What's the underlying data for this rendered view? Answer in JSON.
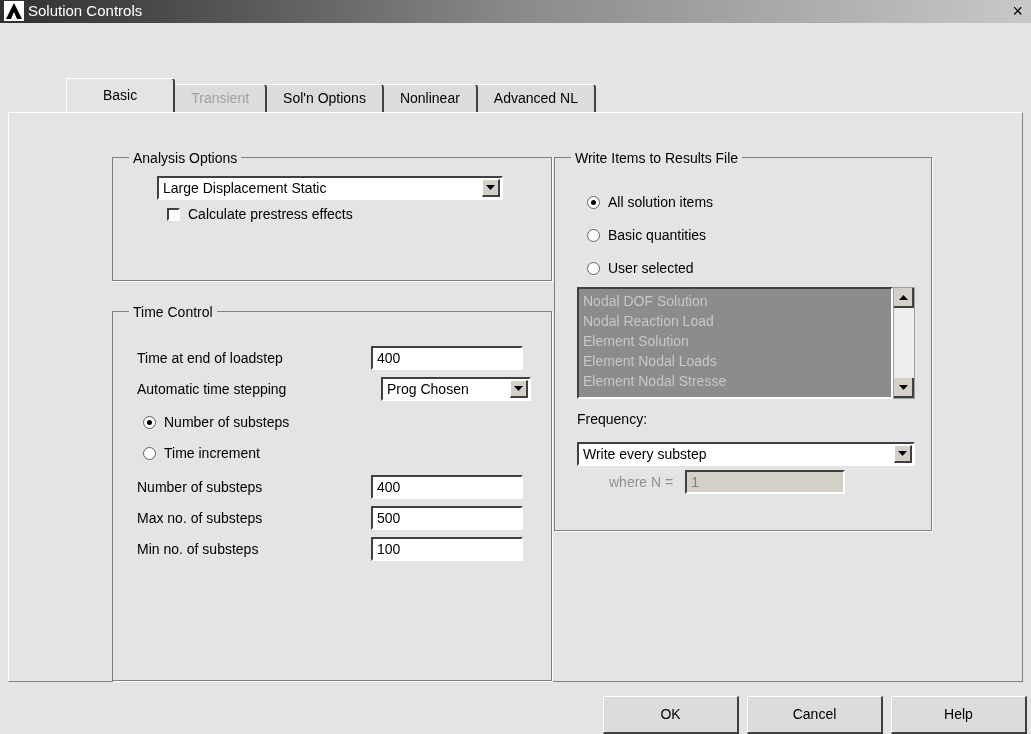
{
  "window": {
    "title": "Solution Controls",
    "close": "×"
  },
  "tabs": [
    {
      "label": "Basic",
      "selected": true,
      "disabled": false
    },
    {
      "label": "Transient",
      "selected": false,
      "disabled": true
    },
    {
      "label": "Sol'n Options",
      "selected": false,
      "disabled": false
    },
    {
      "label": "Nonlinear",
      "selected": false,
      "disabled": false
    },
    {
      "label": "Advanced NL",
      "selected": false,
      "disabled": false
    }
  ],
  "analysis_options": {
    "title": "Analysis Options",
    "analysis_type": "Large Displacement Static",
    "prestress": {
      "label": "Calculate prestress effects",
      "checked": false
    }
  },
  "time_control": {
    "title": "Time Control",
    "end_time": {
      "label": "Time at end of loadstep",
      "value": "400"
    },
    "auto_stepping": {
      "label": "Automatic time stepping",
      "value": "Prog Chosen"
    },
    "mode": [
      {
        "label": "Number of substeps",
        "selected": true
      },
      {
        "label": "Time increment",
        "selected": false
      }
    ],
    "fields": [
      {
        "label": "Number of substeps",
        "value": "400"
      },
      {
        "label": "Max no. of substeps",
        "value": "500"
      },
      {
        "label": "Min no. of substeps",
        "value": "100"
      }
    ]
  },
  "write_items": {
    "title": "Write Items to Results File",
    "options": [
      {
        "label": "All solution items",
        "selected": true
      },
      {
        "label": "Basic quantities",
        "selected": false
      },
      {
        "label": "User selected",
        "selected": false
      }
    ],
    "items_disabled": true,
    "items": [
      "Nodal DOF Solution",
      "Nodal Reaction Load",
      "Element Solution",
      "Element Nodal Loads",
      "Element Nodal Stresse"
    ],
    "frequency": {
      "label": "Frequency:",
      "value": "Write every substep"
    },
    "where_n": {
      "label": "where N =",
      "value": "1",
      "disabled": true
    }
  },
  "buttons": [
    "OK",
    "Cancel",
    "Help"
  ]
}
